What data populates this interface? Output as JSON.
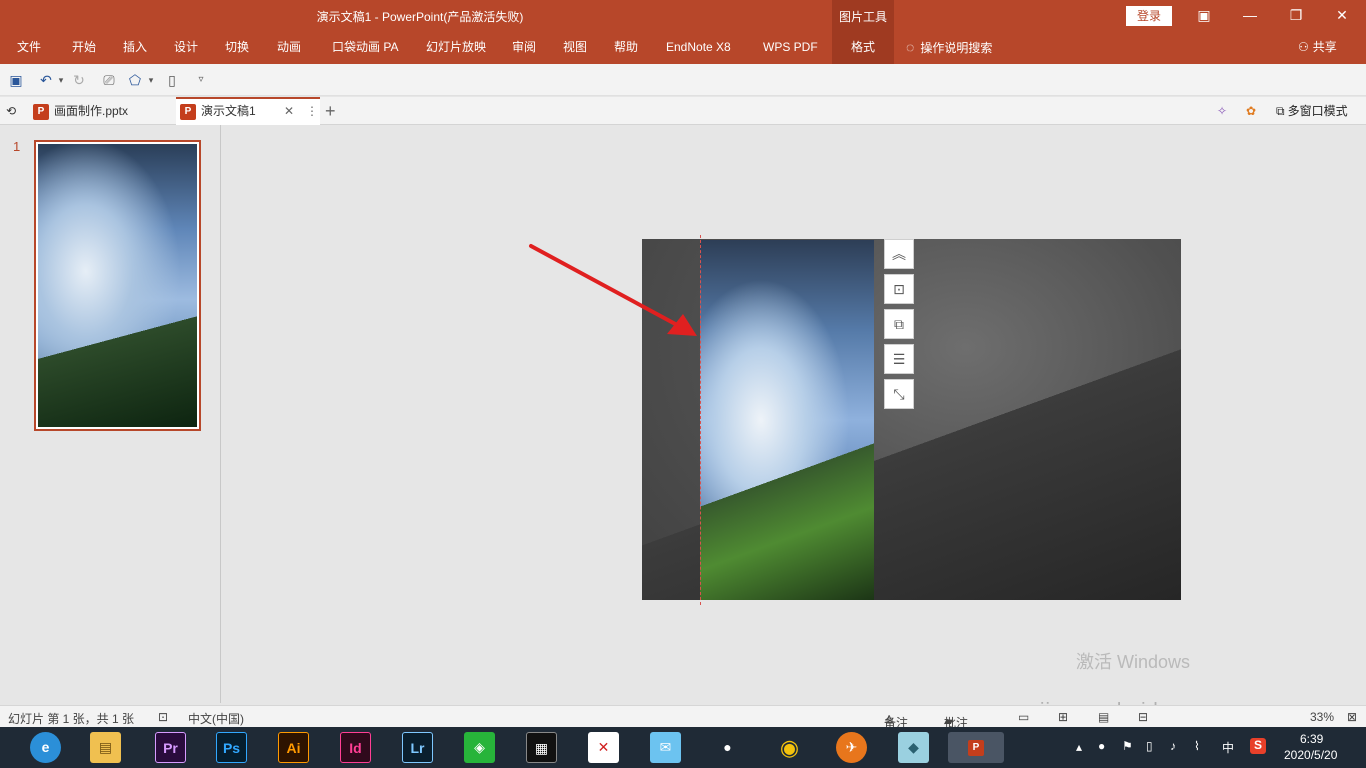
{
  "window": {
    "title": "演示文稿1  -  PowerPoint(产品激活失败)",
    "context_tab_group": "图片工具",
    "login_label": "登录",
    "controls": {
      "ribbon_display": "▣",
      "minimize": "—",
      "restore": "❐",
      "close": "✕"
    }
  },
  "ribbon": {
    "tabs": [
      "文件",
      "开始",
      "插入",
      "设计",
      "切换",
      "动画",
      "口袋动画 PA",
      "幻灯片放映",
      "审阅",
      "视图",
      "帮助",
      "EndNote X8",
      "WPS PDF",
      "格式"
    ],
    "active_tab": "格式",
    "tell_me": "操作说明搜索",
    "share": "共享"
  },
  "quick_access": {
    "icons": [
      "save-icon",
      "undo-icon",
      "redo-icon",
      "present-icon",
      "shapes-icon",
      "new-file-icon",
      "customize-icon"
    ]
  },
  "doc_tabs": {
    "tabs": [
      {
        "name": "画面制作.pptx",
        "active": false
      },
      {
        "name": "演示文稿1",
        "active": true
      }
    ],
    "new_tab": "+",
    "multi_window": "多窗口模式"
  },
  "thumbnails": {
    "slide_number": "1"
  },
  "slide_side_buttons": [
    "layout-options-icon",
    "align-center-icon",
    "arrange-icon",
    "wrap-icon",
    "crop-icon"
  ],
  "watermark": {
    "line1": "激活 Windows",
    "line2": "jingyan.baidu.com"
  },
  "status_bar": {
    "slide_info": "幻灯片 第 1 张，共 1 张",
    "language": "中文(中国)",
    "notes": "备注",
    "comments": "批注",
    "zoom": "33%"
  },
  "taskbar": {
    "apps": [
      "Edge",
      "文件资源管理器",
      "Pr",
      "Ps",
      "Ai",
      "Id",
      "Lr",
      "WinRAR",
      "剪映",
      "XMind",
      "钉钉",
      "QQ",
      "Chrome",
      "Foxmail",
      "便签",
      "PowerPoint"
    ],
    "clock_time": "6:39",
    "clock_date": "2020/5/20",
    "ime": "中",
    "ime_brand": "S"
  },
  "colors": {
    "accent": "#b7472a",
    "accent_dark": "#9f3a21",
    "arrow": "#e02020"
  }
}
